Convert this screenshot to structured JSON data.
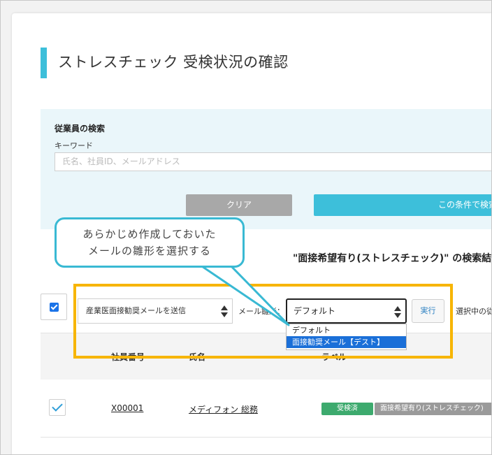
{
  "page": {
    "title": "ストレスチェック 受検状況の確認"
  },
  "search": {
    "heading": "従業員の検索",
    "keyword_label": "キーワード",
    "keyword_placeholder": "氏名、社員ID、メールアドレス",
    "clear_label": "クリア",
    "submit_label": "この条件で検索"
  },
  "callout": {
    "line1": "あらかじめ作成しておいた",
    "line2": "メールの雛形を選択する"
  },
  "results": {
    "title": "\"面接希望有り(ストレスチェック)\" の検索結果"
  },
  "toolbar": {
    "action_selected": "産業医面接勧奨メールを送信",
    "template_label": "メール雛形：",
    "template_selected": "デフォルト",
    "run_label": "実行",
    "selected_text": "選択中の従業員"
  },
  "dropdown": {
    "options": [
      "デフォルト",
      "面接勧奨メール【デスト】"
    ]
  },
  "table": {
    "headers": {
      "id": "社員番号",
      "name": "氏名",
      "label": "ラベル"
    },
    "rows": [
      {
        "id": "X00001",
        "name": "メディフォン 総務",
        "status": "受検済",
        "tag": "面接希望有り(ストレスチェック)"
      }
    ]
  },
  "colors": {
    "accent": "#3dbfda",
    "highlight": "#f7b500",
    "status_done": "#3daa6e",
    "option_selected": "#1a6fd8"
  }
}
